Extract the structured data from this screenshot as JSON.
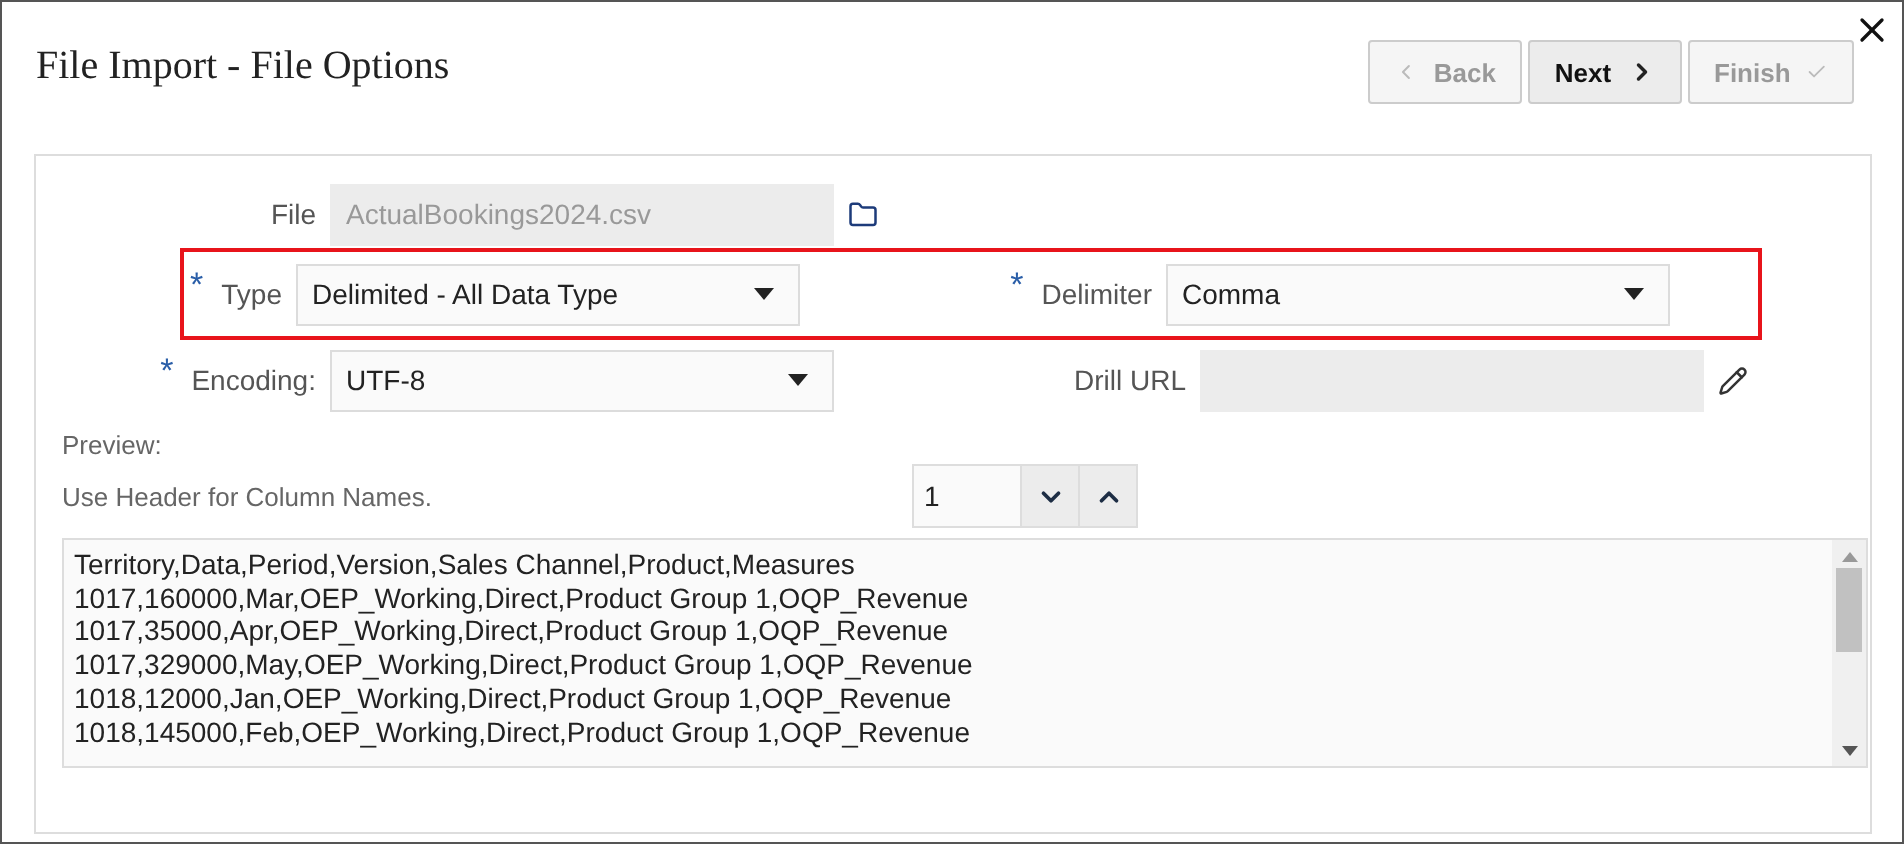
{
  "dialog": {
    "title": "File Import - File Options"
  },
  "buttons": [
    {
      "label": "Back",
      "kind": "back",
      "disabled": true
    },
    {
      "label": "Next",
      "kind": "next",
      "disabled": false
    },
    {
      "label": "Finish",
      "kind": "finish",
      "disabled": true
    }
  ],
  "rows": [
    {
      "highlighted": false,
      "fields": [
        {
          "label": "File",
          "kind": "file",
          "value": "ActualBookings2024.csv",
          "disabled": true
        }
      ]
    },
    {
      "highlighted": true,
      "fields": [
        {
          "label": "Type",
          "kind": "select",
          "value": "Delimited - All Data Type",
          "required_mark": "*",
          "disabled": false
        },
        {
          "label": "Delimiter",
          "kind": "select",
          "value": "Comma",
          "required_mark": "*",
          "disabled": false
        }
      ]
    },
    {
      "highlighted": false,
      "fields": [
        {
          "label": "Encoding:",
          "kind": "select",
          "value": "UTF-8",
          "required_mark": "*",
          "disabled": false
        },
        {
          "label": "Drill URL",
          "kind": "url",
          "disabled": true
        }
      ]
    }
  ],
  "preview": {
    "label": "Preview:",
    "header_label": "Use Header for Column Names.",
    "header_rows": "1",
    "lines": [
      "Territory,Data,Period,Version,Sales Channel,Product,Measures",
      "1017,160000,Mar,OEP_Working,Direct,Product Group 1,OQP_Revenue",
      "1017,35000,Apr,OEP_Working,Direct,Product Group 1,OQP_Revenue",
      "1017,329000,May,OEP_Working,Direct,Product Group 1,OQP_Revenue",
      "1018,12000,Jan,OEP_Working,Direct,Product Group 1,OQP_Revenue",
      "1018,145000,Feb,OEP_Working,Direct,Product Group 1,OQP_Revenue"
    ]
  }
}
